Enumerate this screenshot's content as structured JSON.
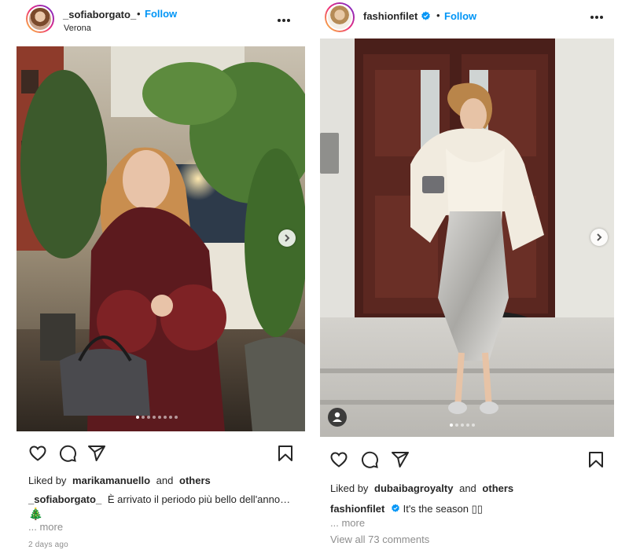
{
  "left_post": {
    "username": "_sofiaborgato_",
    "separator": "•",
    "follow_label": "Follow",
    "location": "Verona",
    "likes_prefix": "Liked by",
    "liked_by_user": "marikamanuello",
    "likes_and": "and",
    "likes_others": "others",
    "caption_user": "_sofiaborgato_",
    "caption_text": "È arrivato il periodo più bello dell'anno…",
    "caption_emoji": "🎄",
    "more_label": "... more",
    "timestamp": "2 days ago",
    "carousel_count": 8,
    "carousel_active": 0
  },
  "right_post": {
    "username": "fashionfilet",
    "separator": "•",
    "follow_label": "Follow",
    "likes_prefix": "Liked by",
    "liked_by_user": "dubaibagroyalty",
    "likes_and": "and",
    "likes_others": "others",
    "caption_user": "fashionfilet",
    "caption_text": "It's the season ",
    "caption_symbols": "▯▯",
    "more_label": "... more",
    "view_comments": "View all 73 comments",
    "carousel_count": 5,
    "carousel_active": 0
  },
  "icons": [
    "heart-icon",
    "comment-icon",
    "share-icon",
    "bookmark-icon",
    "more-options-icon",
    "chevron-right-icon",
    "verified-badge-icon",
    "user-tag-icon"
  ],
  "colors": {
    "link": "#0095f6",
    "text": "#262626",
    "muted": "#8e8e8e",
    "verified": "#0095f6"
  }
}
